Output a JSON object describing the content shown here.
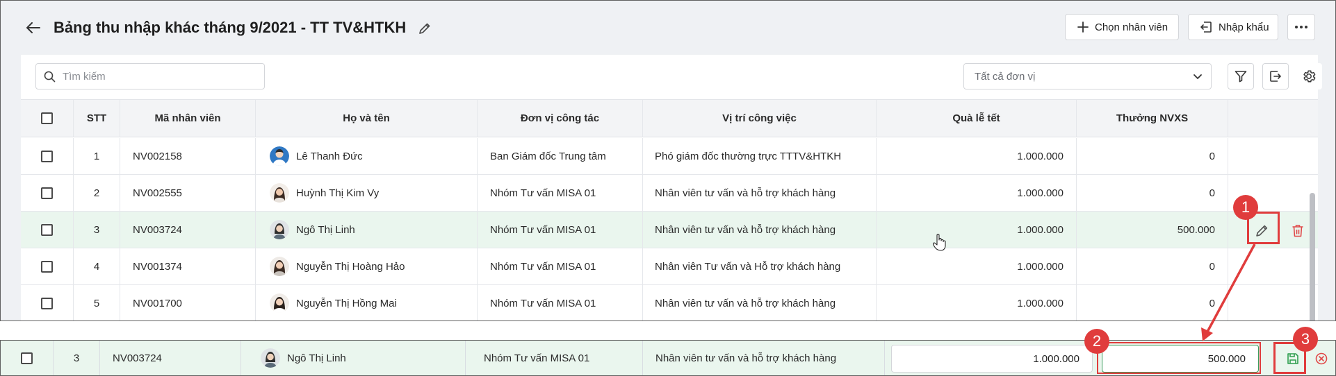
{
  "header": {
    "title": "Bảng thu nhập khác tháng 9/2021 - TT TV&HTKH",
    "choose_employee": "Chọn nhân viên",
    "import": "Nhập khẩu"
  },
  "toolbar": {
    "search_placeholder": "Tìm kiếm",
    "unit_filter": "Tất cả đơn vị"
  },
  "grid": {
    "columns": [
      "STT",
      "Mã nhân viên",
      "Họ và tên",
      "Đơn vị công tác",
      "Vị trí công việc",
      "Quà lễ tết",
      "Thưởng NVXS"
    ],
    "rows": [
      {
        "stt": "1",
        "code": "NV002158",
        "name": "Lê Thanh Đức",
        "unit": "Ban Giám đốc Trung tâm",
        "position": "Phó giám đốc thường trực TTTV&HTKH",
        "gift": "1.000.000",
        "bonus": "0"
      },
      {
        "stt": "2",
        "code": "NV002555",
        "name": "Huỳnh Thị Kim Vy",
        "unit": "Nhóm Tư vấn MISA 01",
        "position": "Nhân viên tư vấn và hỗ trợ khách hàng",
        "gift": "1.000.000",
        "bonus": "0"
      },
      {
        "stt": "3",
        "code": "NV003724",
        "name": "Ngô Thị Linh",
        "unit": "Nhóm Tư vấn MISA 01",
        "position": "Nhân viên tư vấn và hỗ trợ khách hàng",
        "gift": "1.000.000",
        "bonus": "500.000"
      },
      {
        "stt": "4",
        "code": "NV001374",
        "name": "Nguyễn Thị Hoàng Hảo",
        "unit": "Nhóm Tư vấn MISA 01",
        "position": "Nhân viên Tư vấn và Hỗ trợ khách hàng",
        "gift": "1.000.000",
        "bonus": "0"
      },
      {
        "stt": "5",
        "code": "NV001700",
        "name": "Nguyễn Thị Hồng Mai",
        "unit": "Nhóm Tư vấn MISA 01",
        "position": "Nhân viên tư vấn và hỗ trợ khách hàng",
        "gift": "1.000.000",
        "bonus": "0"
      }
    ]
  },
  "edit_row": {
    "stt": "3",
    "code": "NV003724",
    "name": "Ngô Thị Linh",
    "unit": "Nhóm Tư vấn MISA 01",
    "position": "Nhân viên tư vấn và hỗ trợ khách hàng",
    "gift_value": "1.000.000",
    "bonus_value": "500.000"
  },
  "annotations": {
    "step1": "1",
    "step2": "2",
    "step3": "3"
  },
  "colors": {
    "active_row": "#eaf6ee",
    "annotation_red": "#e03c3c",
    "save_green": "#2e9e4f",
    "delete_red": "#e04848"
  }
}
